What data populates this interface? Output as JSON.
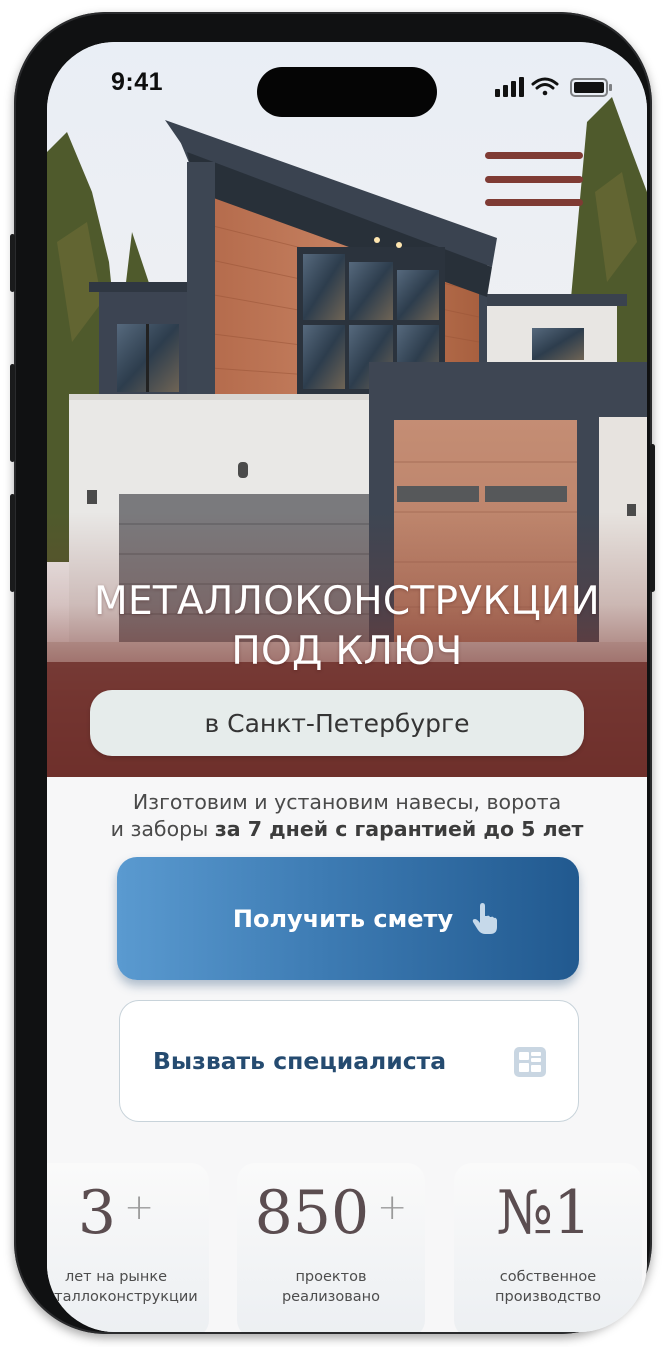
{
  "status_bar": {
    "time": "9:41"
  },
  "hero": {
    "title_line1": "МЕТАЛЛОКОНСТРУКЦИИ",
    "title_line2": "ПОД КЛЮЧ",
    "city_badge": "в Санкт-Петербурге"
  },
  "description": {
    "line1": "Изготовим и установим навесы, ворота",
    "line2_regular": "и заборы ",
    "line2_bold": "за 7 дней с гарантией до 5 лет"
  },
  "buttons": {
    "primary_label": "Получить смету",
    "secondary_label": "Вызвать специалиста"
  },
  "stats": [
    {
      "value": "3",
      "suffix": "+",
      "caption_line1": "лет на рынке",
      "caption_line2": "металлоконструкции"
    },
    {
      "value": "850",
      "suffix": "+",
      "caption_line1": "проектов",
      "caption_line2": "реализовано"
    },
    {
      "value": "№1",
      "suffix": "",
      "caption_line1": "собственное",
      "caption_line2": "производство"
    }
  ],
  "icons": {
    "menu": "hamburger-icon",
    "primary_button": "hand-pointer-icon",
    "secondary_button": "calculator-icon",
    "signal": "cellular-signal-icon",
    "wifi": "wifi-icon",
    "battery": "battery-icon"
  },
  "colors": {
    "accent_maroon": "#7f3b34",
    "primary_button_start": "#5a9ad0",
    "primary_button_end": "#21598f",
    "secondary_text": "#254b70",
    "stat_number": "#5b4d50"
  }
}
